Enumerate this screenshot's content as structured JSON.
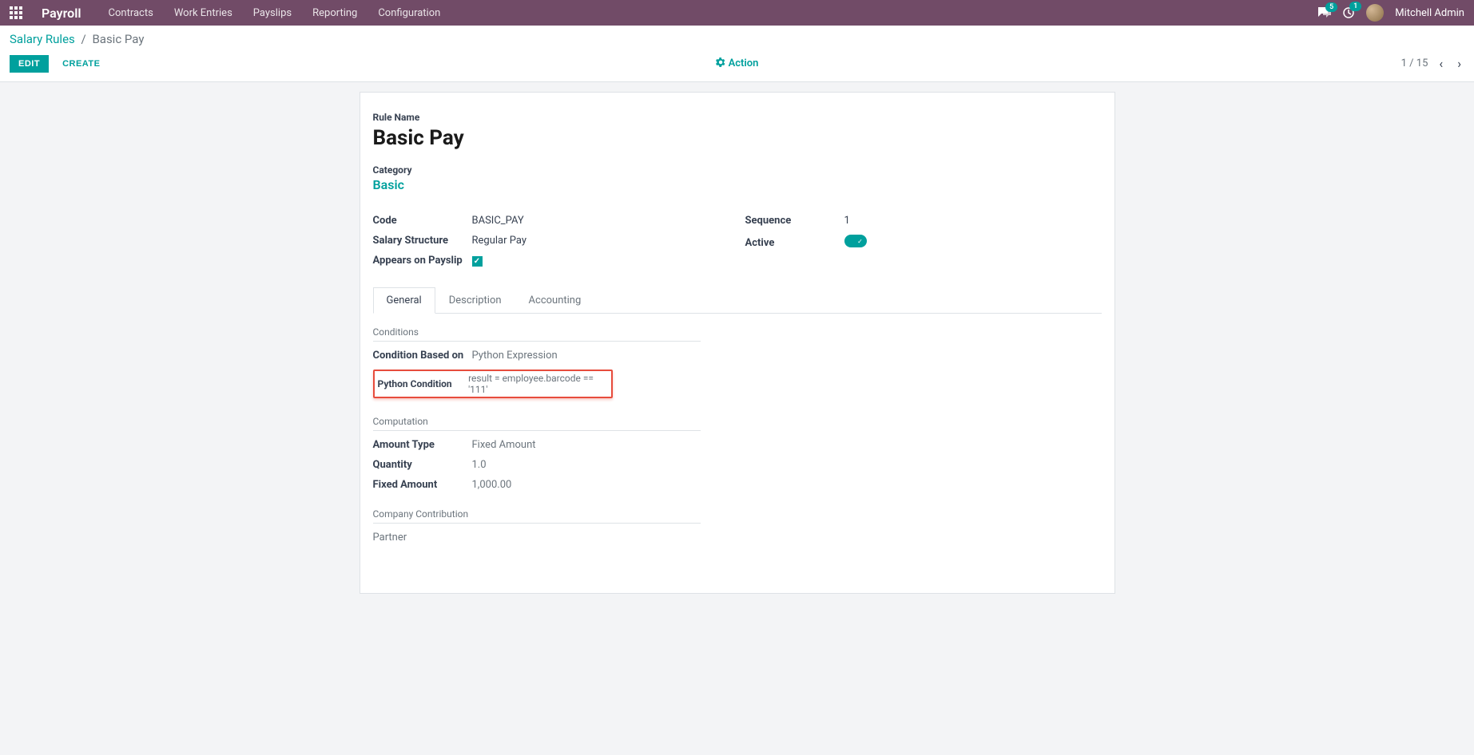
{
  "topbar": {
    "app_title": "Payroll",
    "nav": [
      "Contracts",
      "Work Entries",
      "Payslips",
      "Reporting",
      "Configuration"
    ],
    "messages_badge": "5",
    "activities_badge": "1",
    "user_name": "Mitchell Admin"
  },
  "breadcrumb": {
    "parent": "Salary Rules",
    "current": "Basic Pay"
  },
  "controls": {
    "edit_label": "EDIT",
    "create_label": "CREATE",
    "action_label": "Action",
    "pager_text": "1 / 15"
  },
  "form": {
    "rule_name_label": "Rule Name",
    "rule_name_value": "Basic Pay",
    "category_label": "Category",
    "category_value": "Basic",
    "left_fields": {
      "code_label": "Code",
      "code_value": "BASIC_PAY",
      "salary_structure_label": "Salary Structure",
      "salary_structure_value": "Regular Pay",
      "appears_label": "Appears on Payslip"
    },
    "right_fields": {
      "sequence_label": "Sequence",
      "sequence_value": "1",
      "active_label": "Active"
    },
    "tabs": [
      "General",
      "Description",
      "Accounting"
    ],
    "sections": {
      "conditions": {
        "title": "Conditions",
        "condition_based_label": "Condition Based on",
        "condition_based_value": "Python Expression",
        "python_condition_label": "Python Condition",
        "python_condition_value": "result = employee.barcode == '111'"
      },
      "computation": {
        "title": "Computation",
        "amount_type_label": "Amount Type",
        "amount_type_value": "Fixed Amount",
        "quantity_label": "Quantity",
        "quantity_value": "1.0",
        "fixed_amount_label": "Fixed Amount",
        "fixed_amount_value": "1,000.00"
      },
      "company_contribution": {
        "title": "Company Contribution",
        "partner_label": "Partner"
      }
    }
  }
}
